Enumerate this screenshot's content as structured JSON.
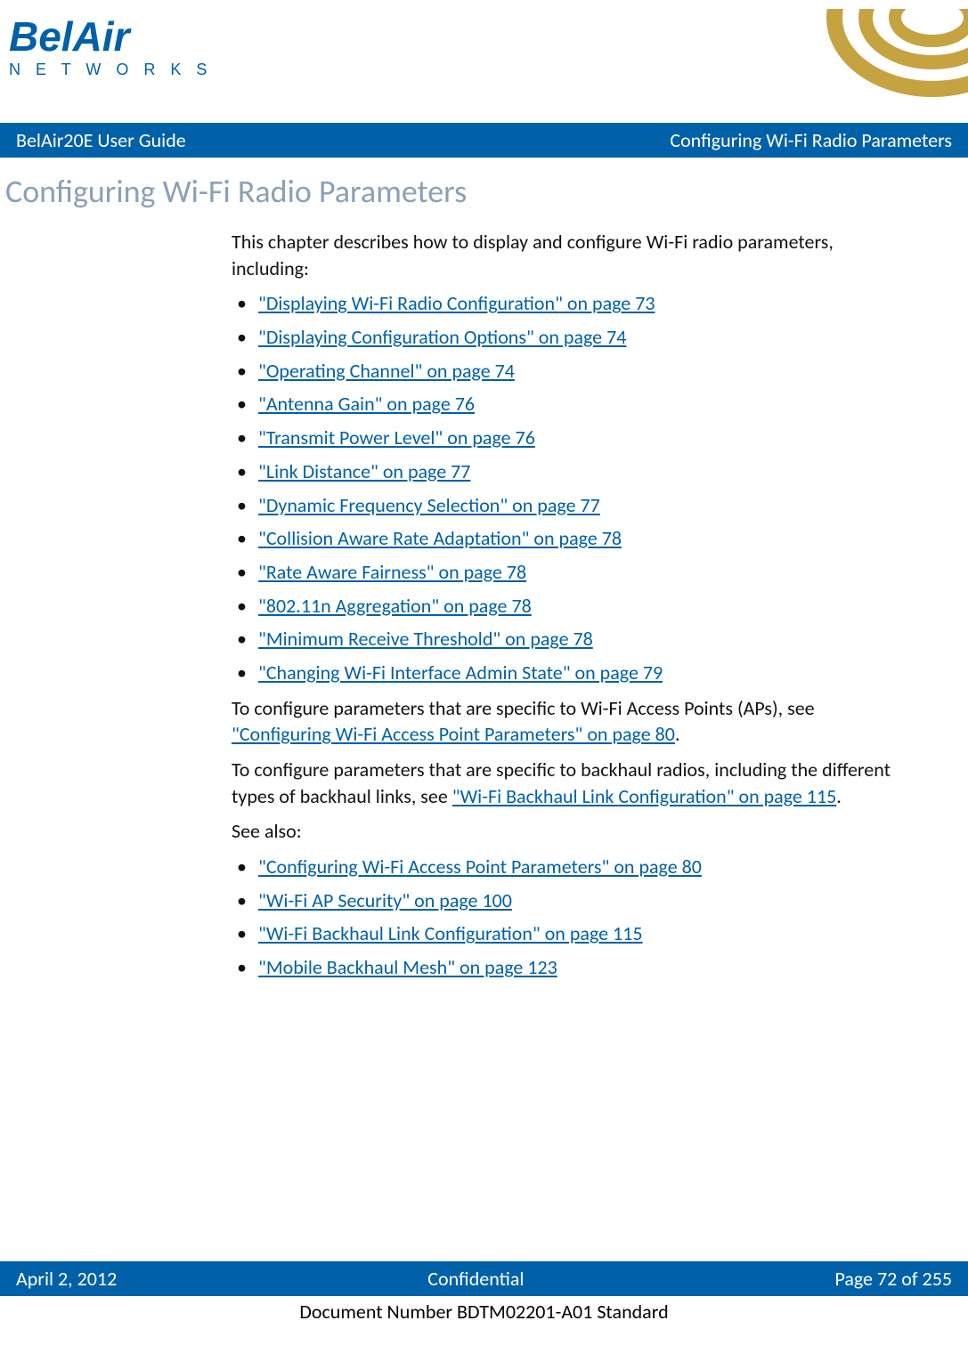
{
  "logo": {
    "brand": "BelAir",
    "sub": "N E T W O R K S"
  },
  "header": {
    "left": "BelAir20E User Guide",
    "right": "Configuring Wi-Fi Radio Parameters"
  },
  "title": "Configuring Wi-Fi Radio Parameters",
  "intro": "This chapter describes how to display and configure Wi-Fi radio parameters, including:",
  "links1": [
    "\"Displaying Wi-Fi Radio Configuration\" on page 73",
    "\"Displaying Configuration Options\" on page 74",
    "\"Operating Channel\" on page 74",
    "\"Antenna Gain\" on page 76",
    "\"Transmit Power Level\" on page 76",
    "\"Link Distance\" on page 77",
    "\"Dynamic Frequency Selection\" on page 77",
    "\"Collision Aware Rate Adaptation\" on page 78",
    "\"Rate Aware Fairness\" on page 78",
    "\"802.11n Aggregation\" on page 78",
    "\"Minimum Receive Threshold\" on page 78",
    "\"Changing Wi-Fi Interface Admin State\" on page 79"
  ],
  "para2": {
    "pre": "To configure parameters that are specific to Wi-Fi Access Points (APs), see ",
    "link": "\"Configuring Wi-Fi Access Point Parameters\" on page 80",
    "post": "."
  },
  "para3": {
    "pre": "To configure parameters that are specific to backhaul radios, including the different types of backhaul links, see ",
    "link": "\"Wi-Fi Backhaul Link Configuration\" on page 115",
    "post": "."
  },
  "seealso_label": "See also:",
  "links2": [
    "\"Configuring Wi-Fi Access Point Parameters\" on page 80",
    "\"Wi-Fi AP Security\" on page 100",
    "\"Wi-Fi Backhaul Link Configuration\" on page 115",
    "\"Mobile Backhaul Mesh\" on page 123"
  ],
  "footer": {
    "left": "April 2, 2012",
    "center": "Confidential",
    "right": "Page 72 of 255"
  },
  "docnum": "Document Number BDTM02201-A01 Standard"
}
